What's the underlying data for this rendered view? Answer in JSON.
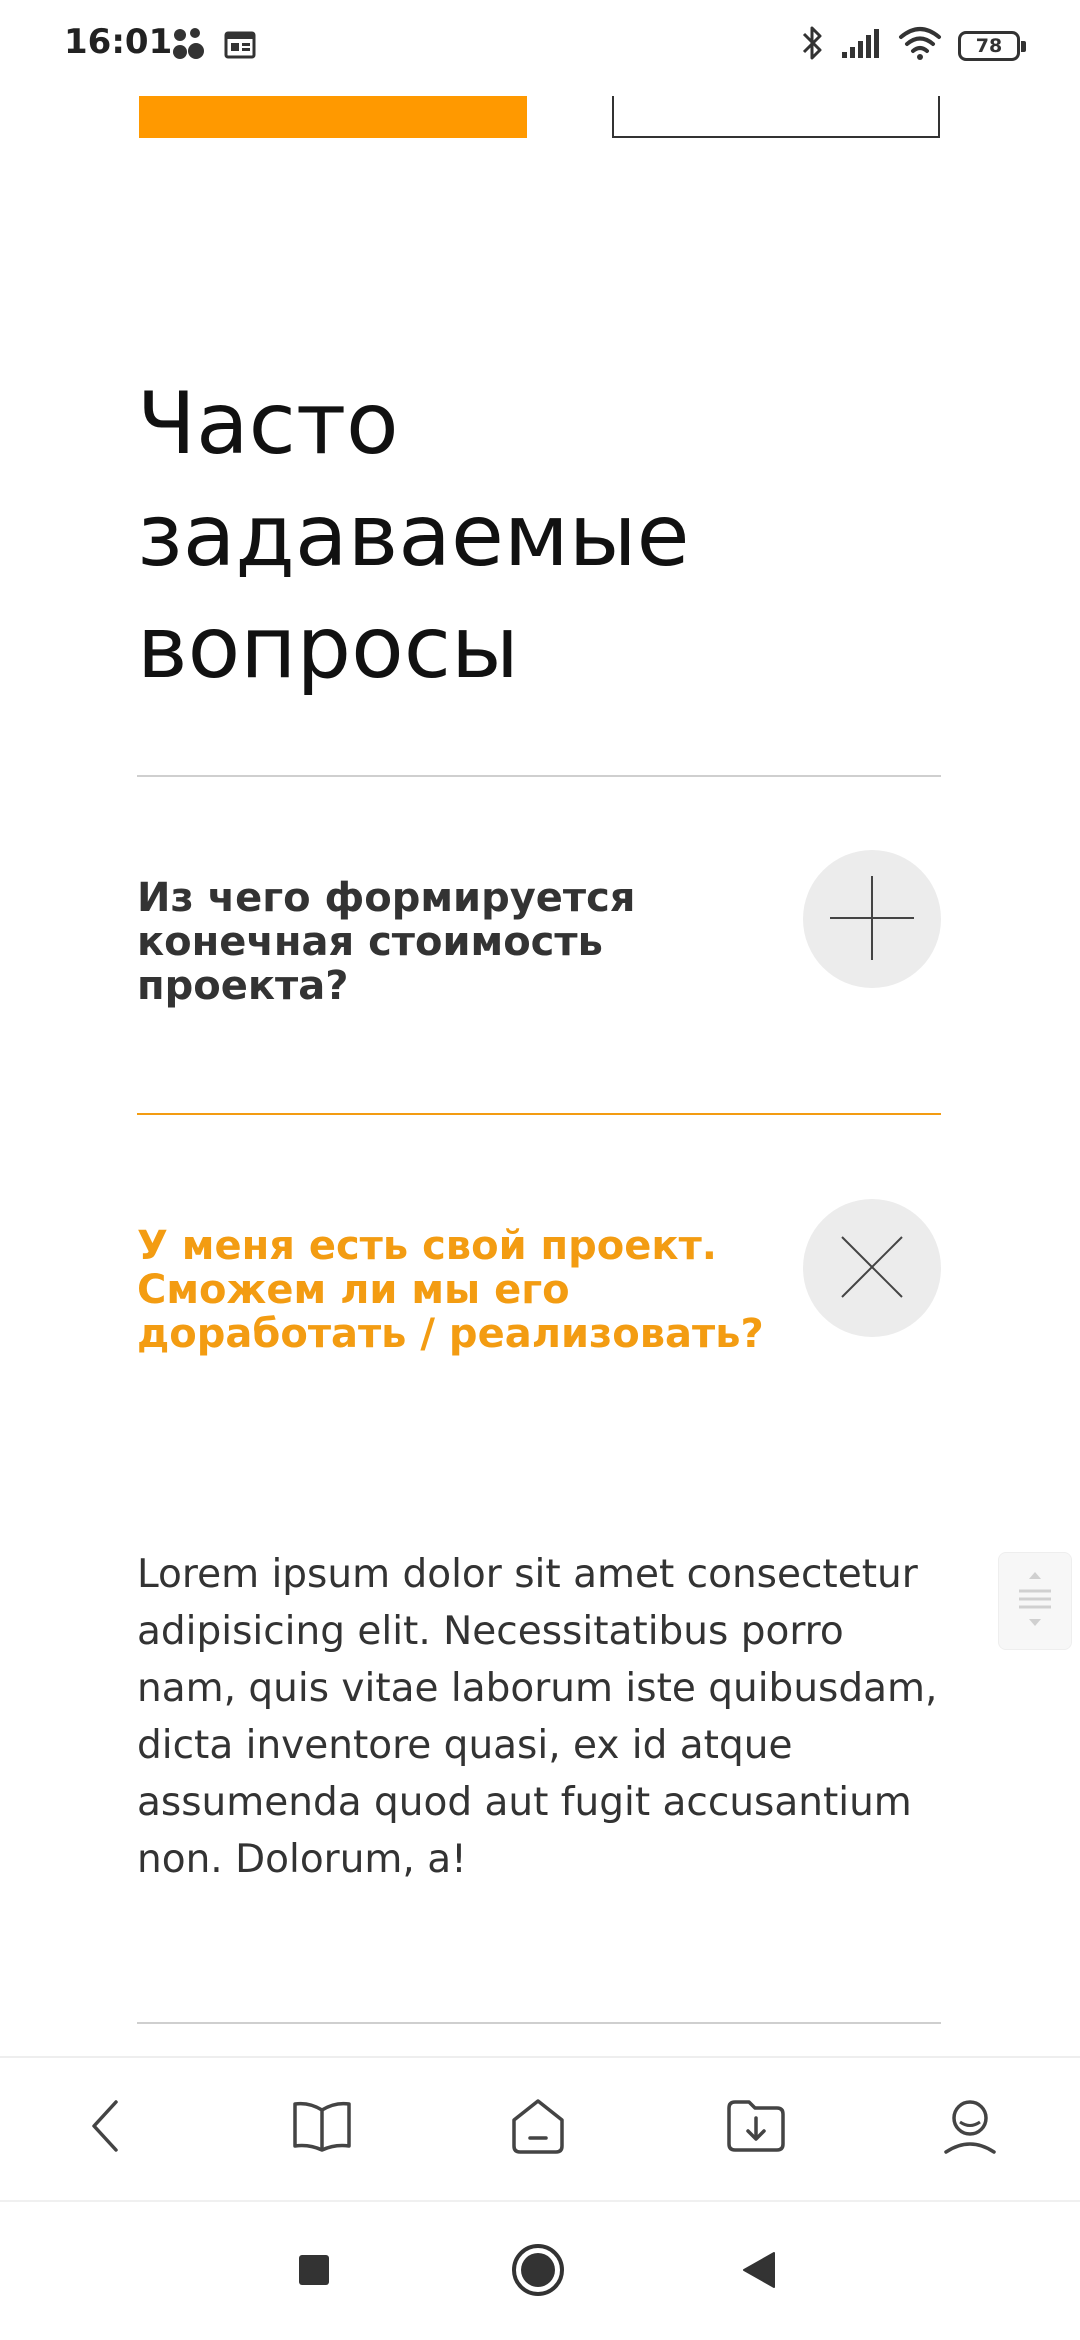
{
  "status_bar": {
    "time": "16:01",
    "battery": "78"
  },
  "faq": {
    "title": "Часто\nзадаваемые\nвопросы",
    "items": [
      {
        "question": "Из чего формируется\nконечная стоимость\nпроекта?",
        "expanded": false,
        "toggle_icon": "plus-icon"
      },
      {
        "question": "У меня есть свой проект.\nСможем ли мы его\nдоработать / реализовать?",
        "expanded": true,
        "toggle_icon": "close-icon",
        "answer": "Lorem ipsum dolor sit amet consectetur adipisicing elit. Necessitatibus porro nam, quis vitae laborum iste quibusdam, dicta inventore quasi, ex id atque assumenda quod aut fugit accusantium non. Dolorum, a!"
      }
    ]
  },
  "browser_toolbar": {
    "items": [
      "back-icon",
      "bookmarks-icon",
      "home-icon",
      "downloads-icon",
      "profile-icon"
    ]
  },
  "system_nav": {
    "items": [
      "recents-icon",
      "home-icon",
      "back-icon"
    ]
  },
  "colors": {
    "accent": "#FF9900",
    "accent_text": "#F39C12",
    "divider": "#CFCFCF",
    "toggle_bg": "#ECECEC",
    "text": "#333333"
  }
}
